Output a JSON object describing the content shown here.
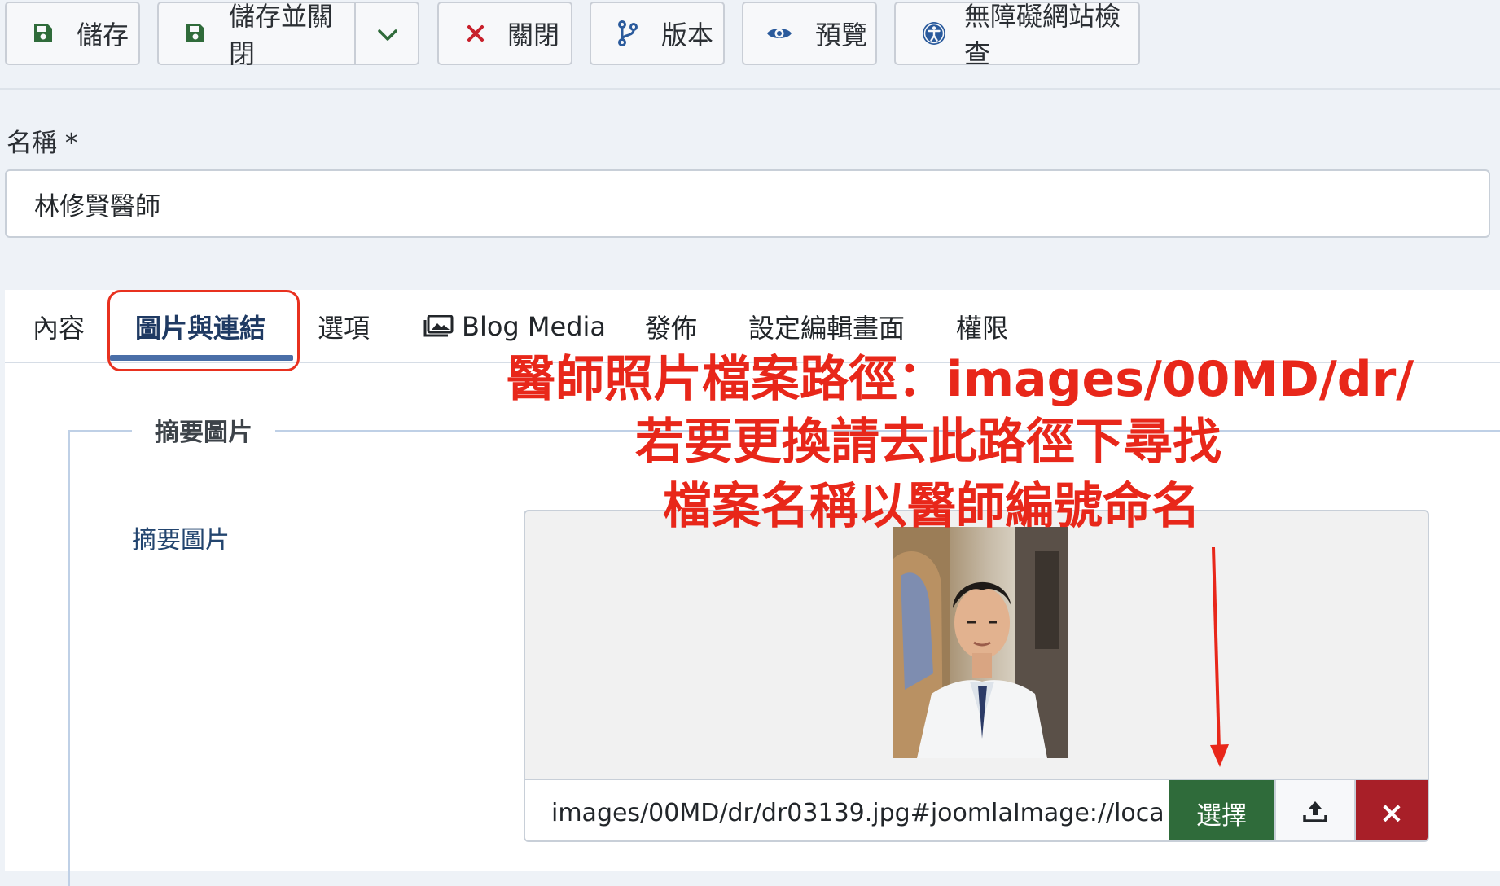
{
  "toolbar": {
    "save": "儲存",
    "save_close": "儲存並關閉",
    "close": "關閉",
    "versions": "版本",
    "preview": "預覽",
    "accessibility": "無障礙網站檢查"
  },
  "form": {
    "name_label": "名稱 *",
    "name_value": "林修賢醫師"
  },
  "tabs": [
    {
      "label": "內容"
    },
    {
      "label": "圖片與連結",
      "active": true
    },
    {
      "label": "選項"
    },
    {
      "label": "Blog Media"
    },
    {
      "label": "發佈"
    },
    {
      "label": "設定編輯畫面"
    },
    {
      "label": "權限"
    }
  ],
  "images": {
    "legend": "摘要圖片",
    "field_label": "摘要圖片",
    "path_value": "images/00MD/dr/dr03139.jpg#joomlaImage://loca",
    "select_label": "選擇",
    "clear_symbol": "×"
  },
  "annotation": {
    "line1": "醫師照片檔案路徑：images/00MD/dr/",
    "line2": "若要更換請去此路徑下尋找",
    "line3": "檔案名稱以醫師編號命名",
    "color": "#e8271a"
  },
  "colors": {
    "select_button": "#2f6b3a",
    "clear_button": "#a81f28",
    "tab_active": "#1f3a63",
    "highlight": "#e8311f"
  },
  "icons": {
    "save": "floppy-disk-icon",
    "close": "x-icon",
    "versions": "code-branch-icon",
    "preview": "eye-icon",
    "accessibility": "universal-access-icon",
    "dropdown": "chevron-down-icon",
    "blog_media": "images-icon",
    "upload": "upload-icon"
  }
}
